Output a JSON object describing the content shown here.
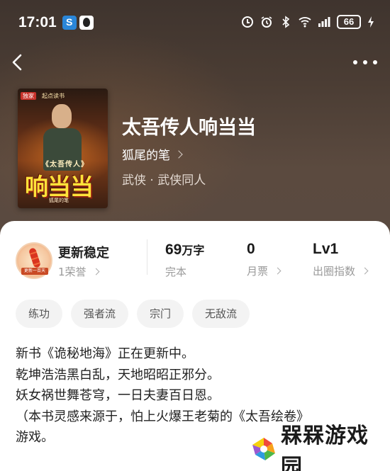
{
  "status_bar": {
    "time": "17:01",
    "battery": "66"
  },
  "book": {
    "title": "太吾传人响当当",
    "author": "狐尾的笔",
    "genre": "武侠 · 武侠同人",
    "cover": {
      "badge": "独家",
      "publisher": "起点读书",
      "subtitle": "《太吾传人》",
      "big_title": "响当当",
      "author": "狐尾的笔"
    }
  },
  "stats": {
    "honor": {
      "label": "更新稳定",
      "count": "1荣誉",
      "medal_text": "更新一百天"
    },
    "words": {
      "value": "69",
      "unit": "万字",
      "label": "完本"
    },
    "tickets": {
      "value": "0",
      "label": "月票"
    },
    "level": {
      "value": "Lv1",
      "label": "出圈指数"
    }
  },
  "tags": [
    "练功",
    "强者流",
    "宗门",
    "无敌流"
  ],
  "intro": [
    "新书《诡秘地海》正在更新中。",
    "乾坤浩浩黑白乱，天地昭昭正邪分。",
    "妖女祸世舞苍穹，一日夫妻百日恩。",
    "（本书灵感来源于，怕上火爆王老菊的《太吾绘卷》",
    "游戏。"
  ],
  "watermark": {
    "text": "槑槑游戏园"
  },
  "colors": {
    "hero_bg": "#4b3d34",
    "tag_bg": "#f3f3f3",
    "muted": "#9a9a9a"
  }
}
